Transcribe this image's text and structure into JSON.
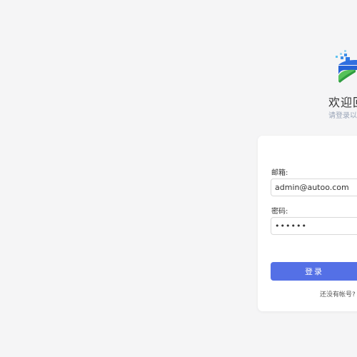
{
  "welcome": {
    "title": "欢迎回",
    "subtitle": "请登录以继"
  },
  "form": {
    "email_label": "邮箱:",
    "email_value": "admin@autoo.com",
    "password_label": "密码:",
    "password_value": "••••••",
    "login_label": "登录",
    "register_prompt": "还没有帐号?"
  },
  "colors": {
    "primary": "#5470e6",
    "background": "#f5f5f6",
    "card": "#ffffff"
  },
  "icons": {
    "logo": "brand-logo-icon"
  }
}
